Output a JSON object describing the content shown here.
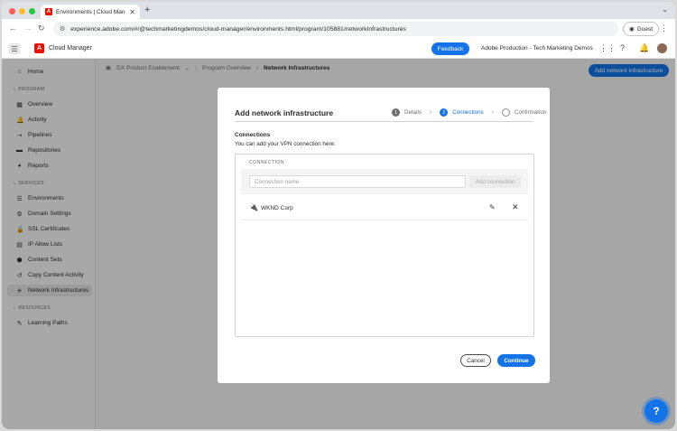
{
  "browser": {
    "tab_title": "Environments | Cloud Manage",
    "tab_favicon": "A",
    "url": "experience.adobe.com/#/@techmarketingdemos/cloud-manager/environments.html/program/105881/networkInfrastructures",
    "guest_label": "Guest"
  },
  "header": {
    "app_name": "Cloud Manager",
    "logo_letter": "A",
    "feedback_label": "Feedback",
    "org_name": "Adobe Production - Tech Marketing Demos",
    "accent": "#1473e6",
    "brand": "#eb1000"
  },
  "sidebar": {
    "home": "Home",
    "program_heading": "PROGRAM",
    "program_items": [
      "Overview",
      "Activity",
      "Pipelines",
      "Repositories",
      "Reports"
    ],
    "services_heading": "SERVICES",
    "services_items": [
      "Environments",
      "Domain Settings",
      "SSL Certificates",
      "IP Allow Lists",
      "Content Sets",
      "Copy Content Activity",
      "Network Infrastructures"
    ],
    "resources_heading": "RESOURCES",
    "resources_items": [
      "Learning Paths"
    ]
  },
  "main": {
    "program_name": "DX Product Enablement",
    "breadcrumb_parent": "Program Overview",
    "breadcrumb_current": "Network Infrastructures",
    "add_button": "Add network infrastructure"
  },
  "modal": {
    "title": "Add network infrastructure",
    "steps": [
      {
        "num": "1",
        "label": "Details"
      },
      {
        "num": "2",
        "label": "Connections"
      },
      {
        "num": "",
        "label": "Confirmation"
      }
    ],
    "section_title": "Connections",
    "section_desc": "You can add your VPN connection here.",
    "column_header": "CONNECTION",
    "input_placeholder": "Connection name",
    "add_connection_label": "Add connection",
    "connections": [
      "WKND Corp"
    ],
    "cancel_label": "Cancel",
    "continue_label": "Continue"
  },
  "help_label": "?"
}
